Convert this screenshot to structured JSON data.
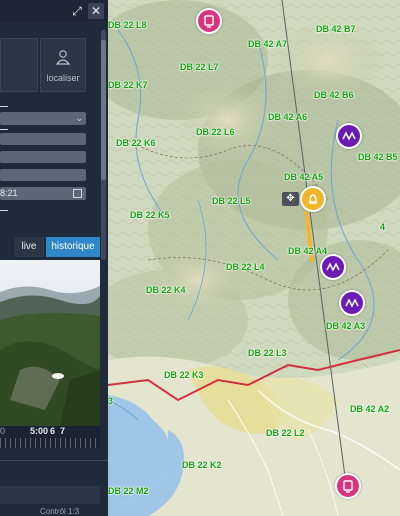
{
  "panel": {
    "localiser_label": "localiser",
    "date_value": "8:21",
    "tabs": {
      "live": "live",
      "historique": "historique"
    },
    "timeline": {
      "t0": "0",
      "t1": "5:00",
      "t2": "6",
      "t3": "7"
    },
    "bottom_text": "Contrôl 1:3"
  },
  "map": {
    "labels": [
      "DB 22 L8",
      "DB 42 A7",
      "DB 42 B7",
      "DB 22 L7",
      "DB 22 K7",
      "DB 42 B6",
      "DB 42 A6",
      "DB 22 L6",
      "DB 22 K6",
      "DB 42 B5",
      "DB 42 A5",
      "DB 22 L5",
      "DB 22 K5",
      "DB 42 A4",
      "DB 22 L4",
      "DB 22 K4",
      "DB 42 A3",
      "DB 22 L3",
      "DB 22 K3",
      "DB 42 A2",
      "DB 22 L2",
      "DB 22 K2",
      "DB 22 M2"
    ],
    "fragments": [
      "4",
      "3"
    ]
  },
  "colors": {
    "panel_bg": "#1f2a3a",
    "accent_blue": "#2f86c9",
    "map_label_green": "#16a30e",
    "marker_purple": "#6b1bb3",
    "marker_pink": "#d7357c",
    "marker_orange": "#f0b52a"
  }
}
